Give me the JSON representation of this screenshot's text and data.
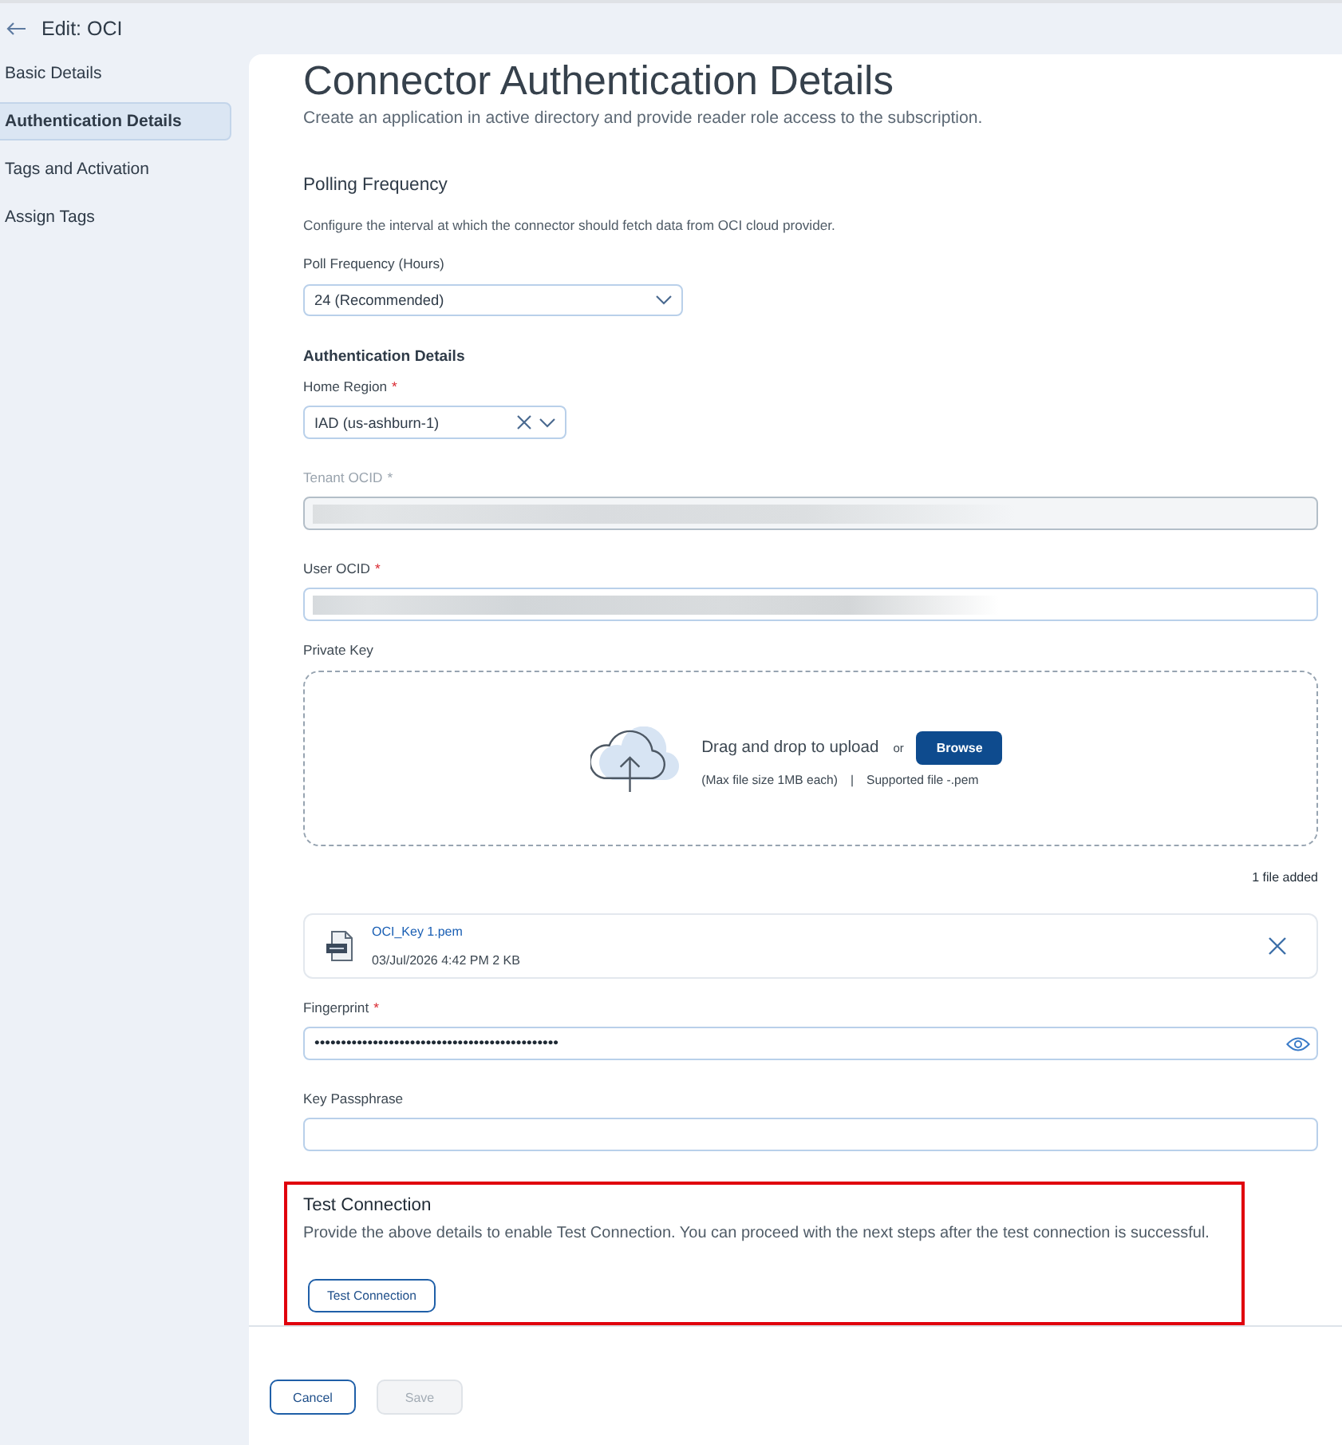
{
  "header": {
    "title": "Edit: OCI"
  },
  "sidebar": {
    "items": [
      {
        "label": "Basic Details",
        "selected": false
      },
      {
        "label": "Authentication Details",
        "selected": true
      },
      {
        "label": "Tags and Activation",
        "selected": false
      },
      {
        "label": "Assign Tags",
        "selected": false
      }
    ]
  },
  "page": {
    "title": "Connector Authentication Details",
    "subtitle": "Create an application in active directory and provide reader role access to the subscription."
  },
  "polling": {
    "heading": "Polling Frequency",
    "description": "Configure the interval at which the connector should fetch data from OCI cloud provider.",
    "field": {
      "label": "Poll Frequency (Hours)",
      "value": "24 (Recommended)"
    }
  },
  "auth": {
    "heading": "Authentication Details",
    "fields": [
      {
        "kind": "select",
        "label": "Home Region",
        "required_mark": "*",
        "value": "IAD (us-ashburn-1)",
        "clearable": true
      },
      {
        "kind": "text",
        "label": "Tenant OCID",
        "required_mark": "*",
        "redacted": true,
        "disabled": true
      },
      {
        "kind": "text",
        "label": "User OCID",
        "required_mark": "*",
        "redacted": true,
        "disabled": false
      },
      {
        "kind": "upload",
        "label": "Private Key",
        "prompt": "Drag and drop to upload",
        "or": "or",
        "button": "Browse",
        "limits": "(Max file size 1MB each)",
        "separator": "|",
        "supported": "Supported file -.pem",
        "count": "1 file added",
        "files": [
          {
            "name": "OCI_Key 1.pem",
            "meta": "03/Jul/2026 4:42 PM 2 KB"
          }
        ]
      },
      {
        "kind": "password",
        "label": "Fingerprint",
        "required_mark": "*",
        "value": "••••••••••••••••••••••••••••••••••••••••••••••"
      },
      {
        "kind": "text",
        "label": "Key Passphrase",
        "disabled": false
      }
    ]
  },
  "test_connection": {
    "heading": "Test Connection",
    "description": "Provide the above details to enable Test Connection. You can proceed with the next steps after the test connection is successful.",
    "button": "Test Connection",
    "highlighted": true
  },
  "footer": {
    "buttons": [
      {
        "label": "Cancel",
        "disabled": false
      },
      {
        "label": "Save",
        "disabled": true
      }
    ]
  }
}
